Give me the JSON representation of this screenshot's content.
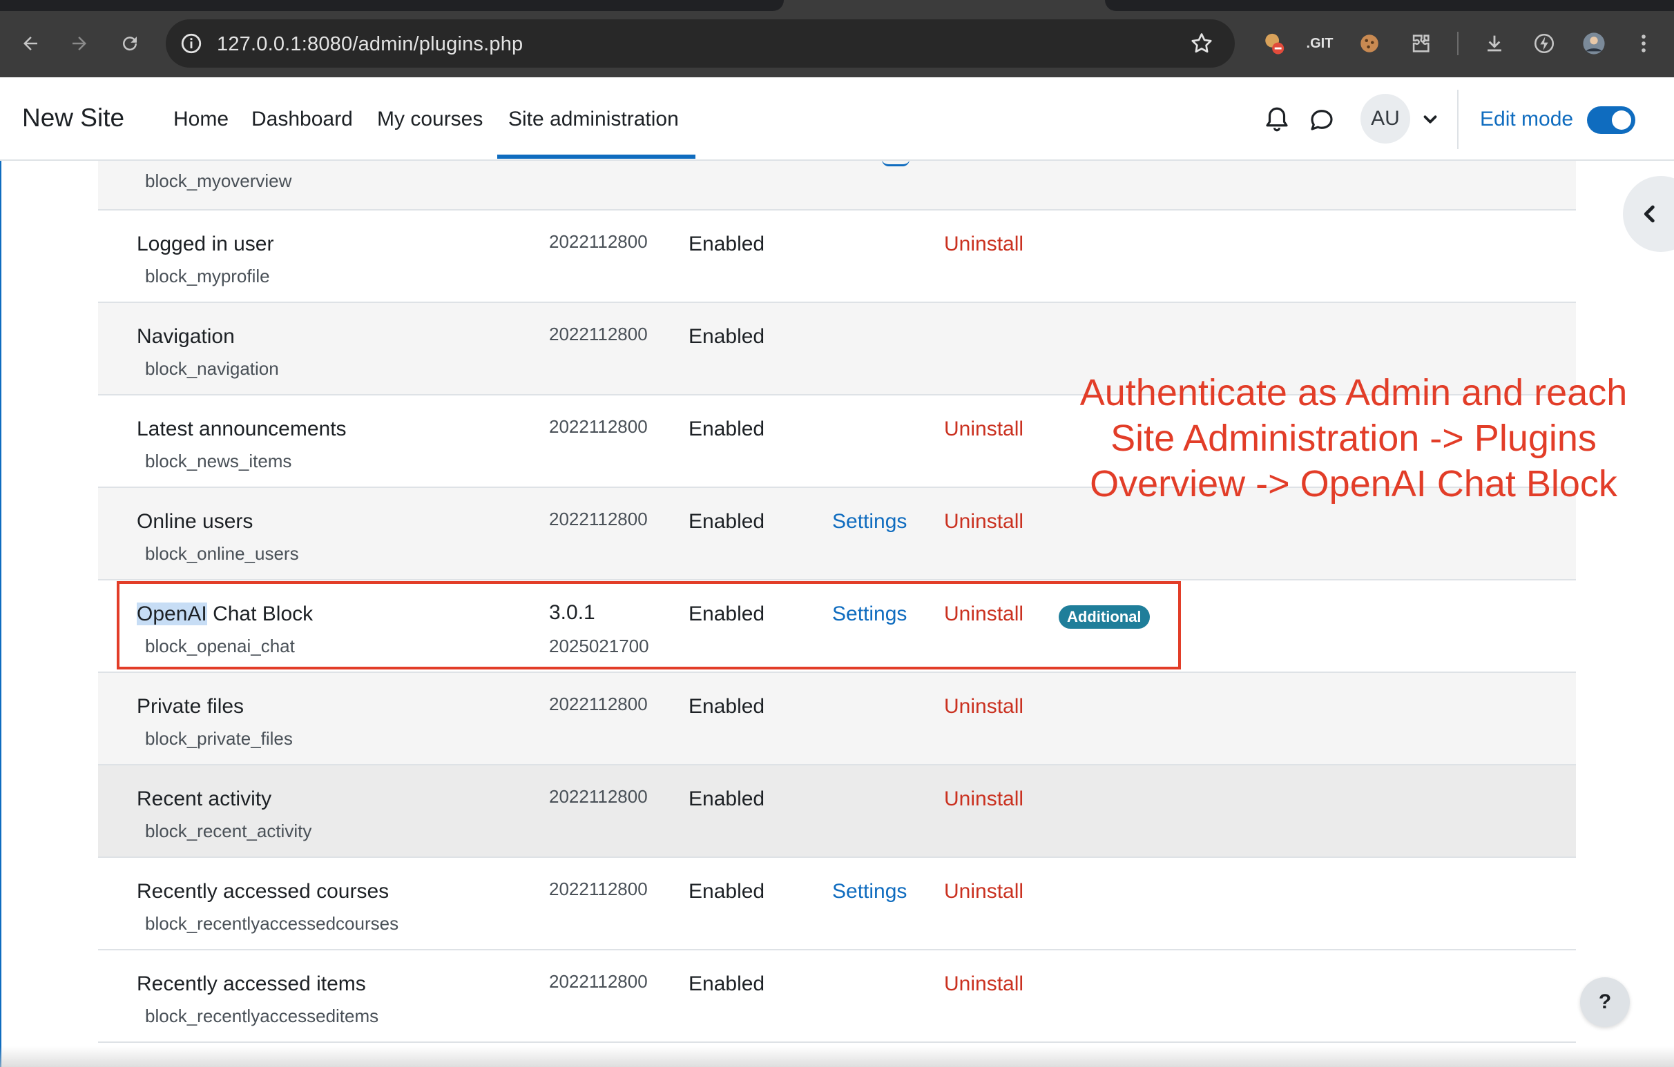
{
  "browser": {
    "url": "127.0.0.1:8080/admin/plugins.php"
  },
  "navbar": {
    "brand": "New Site",
    "links": [
      "Home",
      "Dashboard",
      "My courses",
      "Site administration"
    ],
    "avatar_initials": "AU",
    "edit_mode_label": "Edit mode",
    "edit_mode_on": true
  },
  "plugins": {
    "partial_row": {
      "component": "block_myoverview"
    },
    "rows": [
      {
        "name": "Logged in user",
        "component": "block_myprofile",
        "version": "2022112800",
        "status": "Enabled",
        "settings": "",
        "uninstall": "Uninstall"
      },
      {
        "name": "Navigation",
        "component": "block_navigation",
        "version": "2022112800",
        "status": "Enabled",
        "settings": "",
        "uninstall": ""
      },
      {
        "name": "Latest announcements",
        "component": "block_news_items",
        "version": "2022112800",
        "status": "Enabled",
        "settings": "",
        "uninstall": "Uninstall"
      },
      {
        "name": "Online users",
        "component": "block_online_users",
        "version": "2022112800",
        "status": "Enabled",
        "settings": "Settings",
        "uninstall": "Uninstall"
      },
      {
        "name_highlight": "OpenAI",
        "name_rest": " Chat Block",
        "component": "block_openai_chat",
        "release": "3.0.1",
        "version": "2025021700",
        "status": "Enabled",
        "settings": "Settings",
        "uninstall": "Uninstall",
        "badge": "Additional"
      },
      {
        "name": "Private files",
        "component": "block_private_files",
        "version": "2022112800",
        "status": "Enabled",
        "settings": "",
        "uninstall": "Uninstall"
      },
      {
        "name": "Recent activity",
        "component": "block_recent_activity",
        "version": "2022112800",
        "status": "Enabled",
        "settings": "",
        "uninstall": "Uninstall"
      },
      {
        "name": "Recently accessed courses",
        "component": "block_recentlyaccessedcourses",
        "version": "2022112800",
        "status": "Enabled",
        "settings": "Settings",
        "uninstall": "Uninstall"
      },
      {
        "name": "Recently accessed items",
        "component": "block_recentlyaccesseditems",
        "version": "2022112800",
        "status": "Enabled",
        "settings": "",
        "uninstall": "Uninstall"
      }
    ]
  },
  "annotation": {
    "lines": [
      "Authenticate as Admin and reach",
      "Site Administration -> Plugins",
      "Overview -> OpenAI Chat Block"
    ]
  },
  "help_button": "?"
}
